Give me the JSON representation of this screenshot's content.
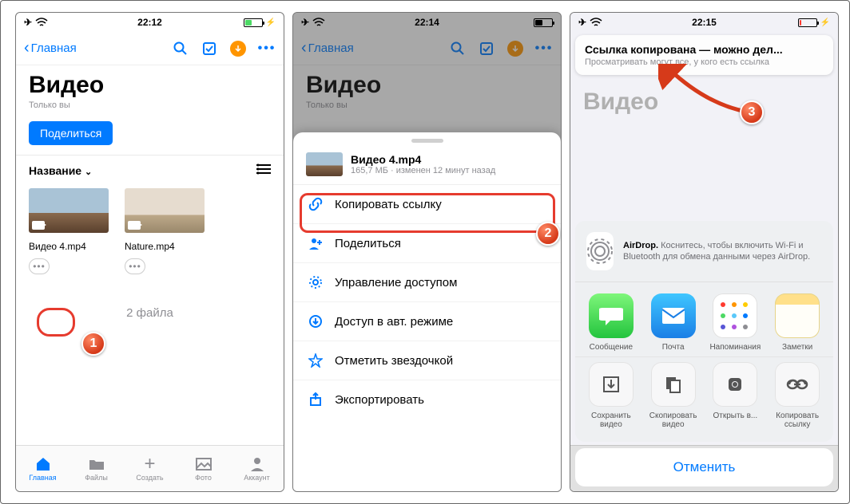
{
  "status": {
    "time1": "22:12",
    "time2": "22:14",
    "time3": "22:15"
  },
  "nav": {
    "back_label": "Главная"
  },
  "page": {
    "title": "Видео",
    "subtitle": "Только вы",
    "share_button": "Поделиться",
    "sort_label": "Название",
    "count": "2 файла"
  },
  "files": [
    {
      "name": "Видео 4.mp4"
    },
    {
      "name": "Nature.mp4"
    }
  ],
  "tabs": {
    "home": "Главная",
    "files": "Файлы",
    "create": "Создать",
    "photo": "Фото",
    "account": "Аккаунт"
  },
  "sheet": {
    "file_title": "Видео 4.mp4",
    "file_meta": "165,7 МБ · изменен 12 минут назад",
    "items": {
      "copy_link": "Копировать ссылку",
      "share": "Поделиться",
      "manage_access": "Управление доступом",
      "offline": "Доступ в авт. режиме",
      "star": "Отметить звездочкой",
      "export": "Экспортировать"
    }
  },
  "toast": {
    "title": "Ссылка копирована — можно дел...",
    "subtitle": "Просматривать могут все, у кого есть ссылка"
  },
  "airdrop": {
    "name": "AirDrop.",
    "desc": "Коснитесь, чтобы включить Wi-Fi и Bluetooth для обмена данными через AirDrop."
  },
  "share_apps": {
    "messages": "Сообщение",
    "mail": "Почта",
    "reminders": "Напоминания",
    "notes": "Заметки"
  },
  "share_actions": {
    "save_video": "Сохранить видео",
    "copy_video": "Скопировать видео",
    "open_in": "Открыть в...",
    "copy_link": "Копировать ссылку"
  },
  "cancel": "Отменить",
  "badges": {
    "b1": "1",
    "b2": "2",
    "b3": "3"
  }
}
